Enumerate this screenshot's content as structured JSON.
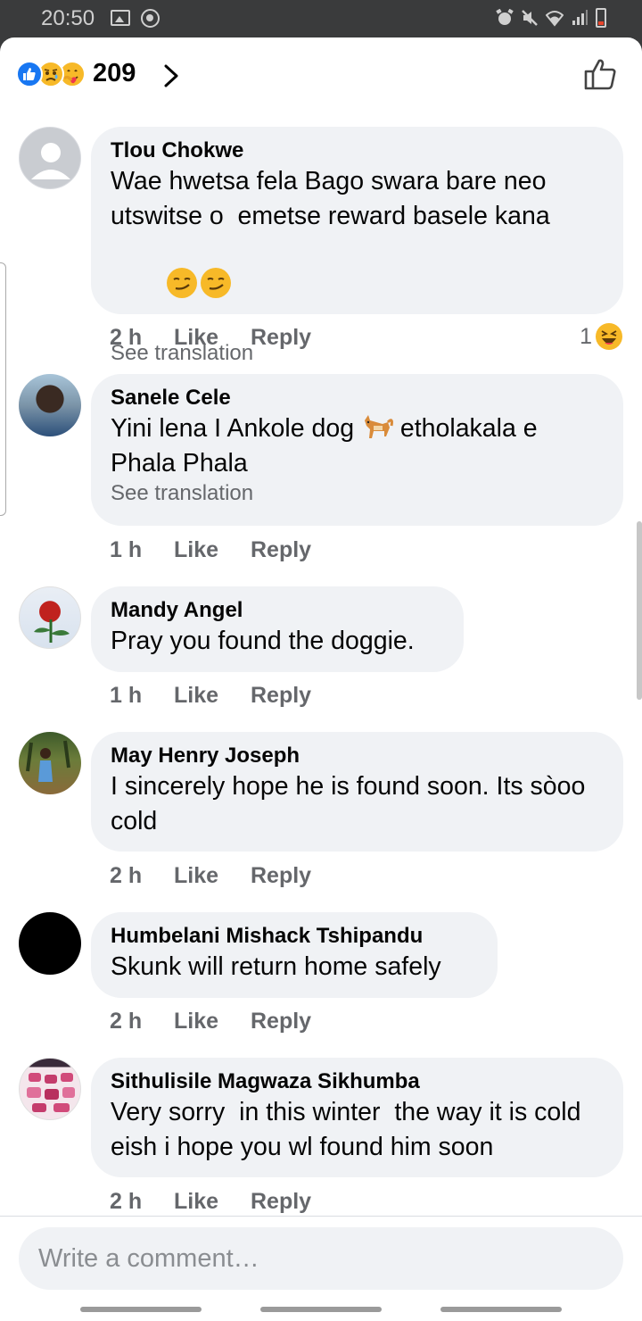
{
  "status_bar": {
    "time": "20:50",
    "icons": [
      "gallery-icon",
      "circle-icon",
      "alarm-icon",
      "mute-icon",
      "wifi-icon",
      "signal-icon",
      "battery-icon"
    ]
  },
  "header": {
    "reaction_icons": [
      "like-reaction-icon",
      "sad-reaction-icon",
      "care-reaction-icon"
    ],
    "reaction_count": "209",
    "like_icon": "thumbs-up-outline-icon"
  },
  "comments": [
    {
      "name": "Tlou Chokwe",
      "text": "Wae hwetsa fela Bago swara bare neo utswitse o  emetse reward basele kana",
      "emoji": "smirk-emoji x2",
      "see_translation": "See translation",
      "time": "2 h",
      "like": "Like",
      "reply": "Reply",
      "reaction_count": "1",
      "reaction_icon": "haha-reaction-icon"
    },
    {
      "name": "Sanele Cele",
      "text_before": "Yini lena I Ankole dog ",
      "text_after": " etholakala e Phala Phala",
      "emoji": "dog-emoji",
      "see_translation": "See translation",
      "time": "1 h",
      "like": "Like",
      "reply": "Reply"
    },
    {
      "name": "Mandy Angel",
      "text": "Pray you found the doggie.",
      "time": "1 h",
      "like": "Like",
      "reply": "Reply"
    },
    {
      "name": "May Henry Joseph",
      "text": "I sincerely hope he is found soon. Its sòoo cold",
      "time": "2 h",
      "like": "Like",
      "reply": "Reply"
    },
    {
      "name": "Humbelani Mishack Tshipandu",
      "text": "Skunk will return home safely",
      "time": "2 h",
      "like": "Like",
      "reply": "Reply"
    },
    {
      "name": "Sithulisile Magwaza Sikhumba",
      "text": "Very sorry  in this winter  the way it is cold eish i hope you wl found him soon",
      "time": "2 h",
      "like": "Like",
      "reply": "Reply"
    }
  ],
  "composer": {
    "placeholder": "Write a comment…"
  },
  "colors": {
    "facebook_blue": "#1877f2",
    "bubble_bg": "#f0f2f5",
    "meta_text": "#65676b",
    "reaction_yellow": "#f7b928"
  }
}
